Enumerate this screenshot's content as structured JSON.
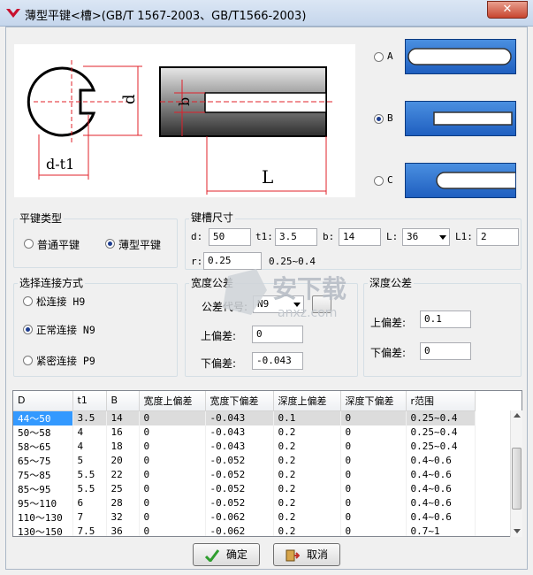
{
  "window": {
    "title": "薄型平键<槽>(GB/T 1567-2003、GB/T1566-2003)",
    "close_label": "✕"
  },
  "diagram": {
    "dim_d": "d",
    "dim_dt1": "d-t1",
    "dim_b": "b",
    "dim_L": "L"
  },
  "key_shape_options": [
    {
      "label": "A",
      "selected": false
    },
    {
      "label": "B",
      "selected": true
    },
    {
      "label": "C",
      "selected": false
    }
  ],
  "key_type_group": {
    "title": "平键类型",
    "options": [
      {
        "label": "普通平键",
        "selected": false
      },
      {
        "label": "薄型平键",
        "selected": true
      }
    ]
  },
  "keyway_group": {
    "title": "键槽尺寸",
    "fields": [
      {
        "label": "d:",
        "value": "50"
      },
      {
        "label": "t1:",
        "value": "3.5"
      },
      {
        "label": "b:",
        "value": "14"
      },
      {
        "label": "L:",
        "value": "36"
      },
      {
        "label": "L1:",
        "value": "2"
      }
    ],
    "r_label": "r:",
    "r_value": "0.25",
    "r_range": "0.25~0.4"
  },
  "connection_group": {
    "title": "选择连接方式",
    "options": [
      {
        "label": "松连接  H9",
        "selected": false
      },
      {
        "label": "正常连接  N9",
        "selected": true
      },
      {
        "label": "紧密连接  P9",
        "selected": false
      }
    ]
  },
  "width_tol_group": {
    "title": "宽度公差",
    "code_label": "公差代号:",
    "code_value": "N9",
    "upper_label": "上偏差:",
    "upper_value": "0",
    "lower_label": "下偏差:",
    "lower_value": "-0.043"
  },
  "depth_tol_group": {
    "title": "深度公差",
    "upper_label": "上偏差:",
    "upper_value": "0.1",
    "lower_label": "下偏差:",
    "lower_value": "0"
  },
  "table": {
    "columns": [
      "D",
      "t1",
      "B",
      "宽度上偏差",
      "宽度下偏差",
      "深度上偏差",
      "深度下偏差",
      "r范围"
    ],
    "rows": [
      [
        "44～50",
        "3.5",
        "14",
        "0",
        "-0.043",
        "0.1",
        "0",
        "0.25~0.4"
      ],
      [
        "50～58",
        "4",
        "16",
        "0",
        "-0.043",
        "0.2",
        "0",
        "0.25~0.4"
      ],
      [
        "58～65",
        "4",
        "18",
        "0",
        "-0.043",
        "0.2",
        "0",
        "0.25~0.4"
      ],
      [
        "65～75",
        "5",
        "20",
        "0",
        "-0.052",
        "0.2",
        "0",
        "0.4~0.6"
      ],
      [
        "75～85",
        "5.5",
        "22",
        "0",
        "-0.052",
        "0.2",
        "0",
        "0.4~0.6"
      ],
      [
        "85～95",
        "5.5",
        "25",
        "0",
        "-0.052",
        "0.2",
        "0",
        "0.4~0.6"
      ],
      [
        "95～110",
        "6",
        "28",
        "0",
        "-0.052",
        "0.2",
        "0",
        "0.4~0.6"
      ],
      [
        "110～130",
        "7",
        "32",
        "0",
        "-0.062",
        "0.2",
        "0",
        "0.4~0.6"
      ],
      [
        "130～150",
        "7.5",
        "36",
        "0",
        "-0.062",
        "0.2",
        "0",
        "0.7~1"
      ]
    ],
    "selected_row": 0
  },
  "buttons": {
    "ok": "确定",
    "cancel": "取消"
  },
  "watermark": {
    "text": "安下载",
    "sub": "anxz.com"
  },
  "colors": {
    "dim_red": "#e0202a",
    "key_blue": "#2a6fd0",
    "selection": "#3399ff"
  }
}
